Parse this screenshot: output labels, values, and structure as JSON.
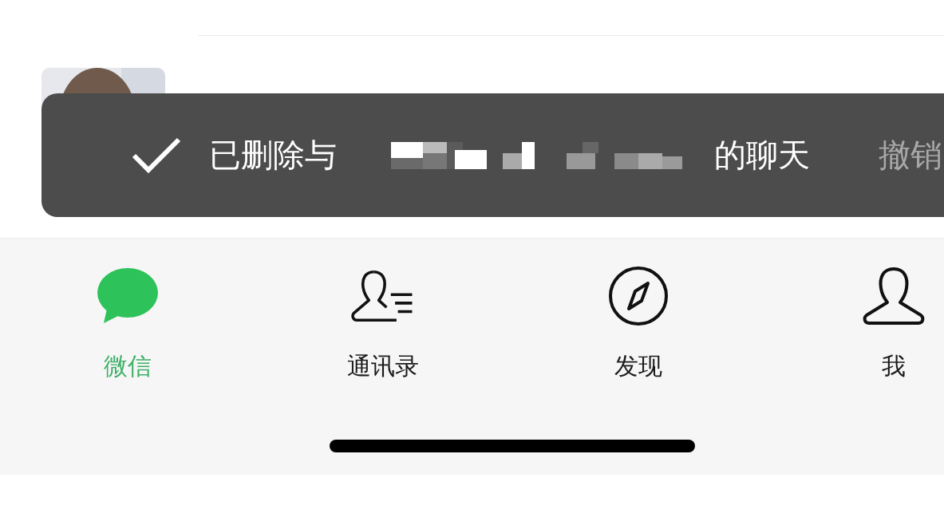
{
  "toast": {
    "message_start": "已删除与",
    "message_end": "的聊天",
    "action": "撤销"
  },
  "tab_bar": {
    "tabs": [
      {
        "label": "微信",
        "kind": "chats",
        "selected": true
      },
      {
        "label": "通讯录",
        "kind": "contacts",
        "selected": false
      },
      {
        "label": "发现",
        "kind": "discover",
        "selected": false
      },
      {
        "label": "我",
        "kind": "me",
        "selected": false
      }
    ]
  }
}
